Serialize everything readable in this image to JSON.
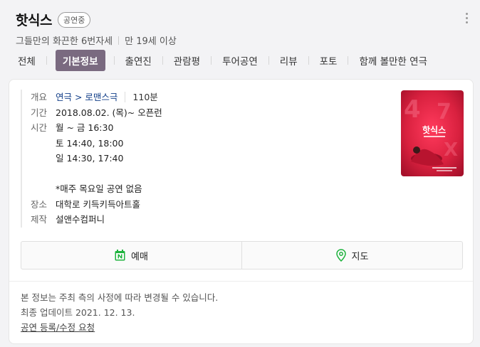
{
  "header": {
    "title": "핫식스",
    "status_badge": "공연중",
    "subtitle_main": "그들만의 화끈한 6번자세",
    "subtitle_age": "만 19세 이상"
  },
  "tabs": [
    {
      "label": "전체"
    },
    {
      "label": "기본정보",
      "active": true
    },
    {
      "label": "출연진"
    },
    {
      "label": "관람평"
    },
    {
      "label": "투어공연"
    },
    {
      "label": "리뷰"
    },
    {
      "label": "포토"
    },
    {
      "label": "함께 볼만한 연극"
    }
  ],
  "info": {
    "overview_label": "개요",
    "genre": "연극 > 로맨스극",
    "running_time": "110분",
    "period_label": "기간",
    "period": "2018.08.02. (목)~ 오픈런",
    "time_label": "시간",
    "times": [
      "월 ~ 금 16:30",
      "토 14:40, 18:00",
      "일 14:30, 17:40"
    ],
    "notice": "*매주 목요일 공연 없음",
    "venue_label": "장소",
    "venue": "대학로 키득키득아트홀",
    "producer_label": "제작",
    "producer": "설앤수컴퍼니"
  },
  "poster": {
    "title_text": "핫식스",
    "accent_color": "#d9213f"
  },
  "actions": {
    "reserve_label": "예매",
    "map_label": "지도"
  },
  "footer": {
    "notice": "본 정보는 주최 측의 사정에 따라 변경될 수 있습니다.",
    "updated": "최종 업데이트 2021. 12. 13.",
    "edit_link": "공연 등록/수정 요청"
  }
}
